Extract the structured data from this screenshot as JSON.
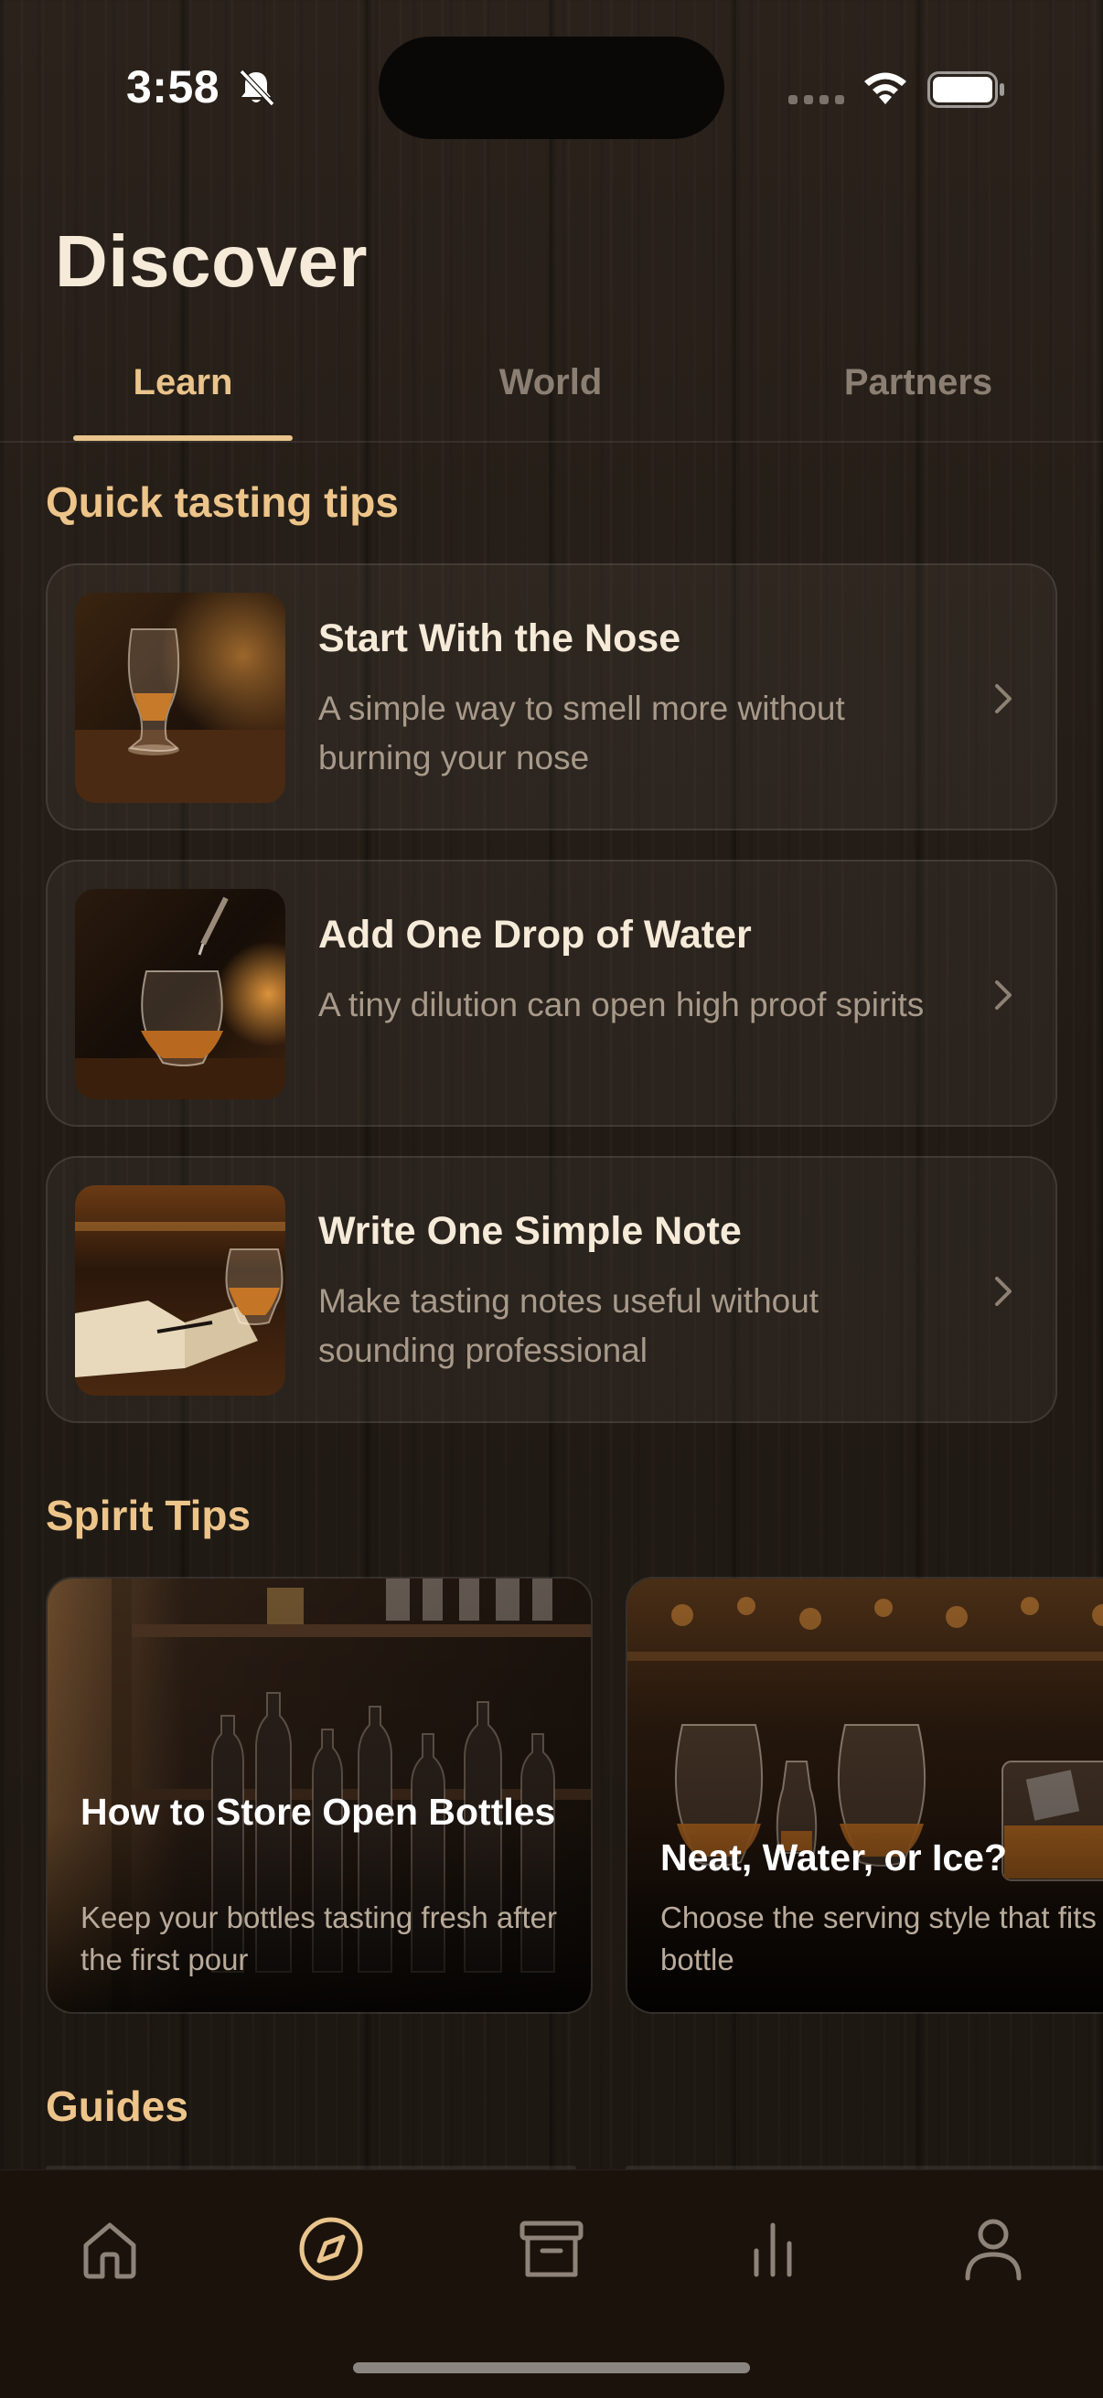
{
  "status_bar": {
    "time": "3:58"
  },
  "header": {
    "title": "Discover"
  },
  "tabs": [
    {
      "label": "Learn",
      "active": true
    },
    {
      "label": "World",
      "active": false
    },
    {
      "label": "Partners",
      "active": false
    }
  ],
  "quick_tips": {
    "section_title": "Quick tasting tips",
    "items": [
      {
        "title": "Start With the Nose",
        "description": "A simple way to smell more without burning your nose"
      },
      {
        "title": "Add One Drop of Water",
        "description": "A tiny dilution can open high proof spirits"
      },
      {
        "title": "Write One Simple Note",
        "description": "Make tasting notes useful without sounding professional"
      }
    ]
  },
  "spirit_tips": {
    "section_title": "Spirit Tips",
    "items": [
      {
        "title": "How to Store Open Bottles",
        "description": "Keep your bottles tasting fresh after the first pour"
      },
      {
        "title": "Neat, Water, or Ice?",
        "description": "Choose the serving style that fits the bottle"
      }
    ]
  },
  "guides": {
    "section_title": "Guides"
  },
  "bottom_nav": {
    "items": [
      {
        "icon": "home-icon",
        "active": false
      },
      {
        "icon": "compass-icon",
        "active": true
      },
      {
        "icon": "archive-box-icon",
        "active": false
      },
      {
        "icon": "bar-chart-icon",
        "active": false
      },
      {
        "icon": "profile-icon",
        "active": false
      }
    ]
  },
  "colors": {
    "accent": "#e9c48c",
    "section_title": "#edc58a",
    "inactive": "#8b7f73",
    "nav_background": "#1c120c"
  }
}
